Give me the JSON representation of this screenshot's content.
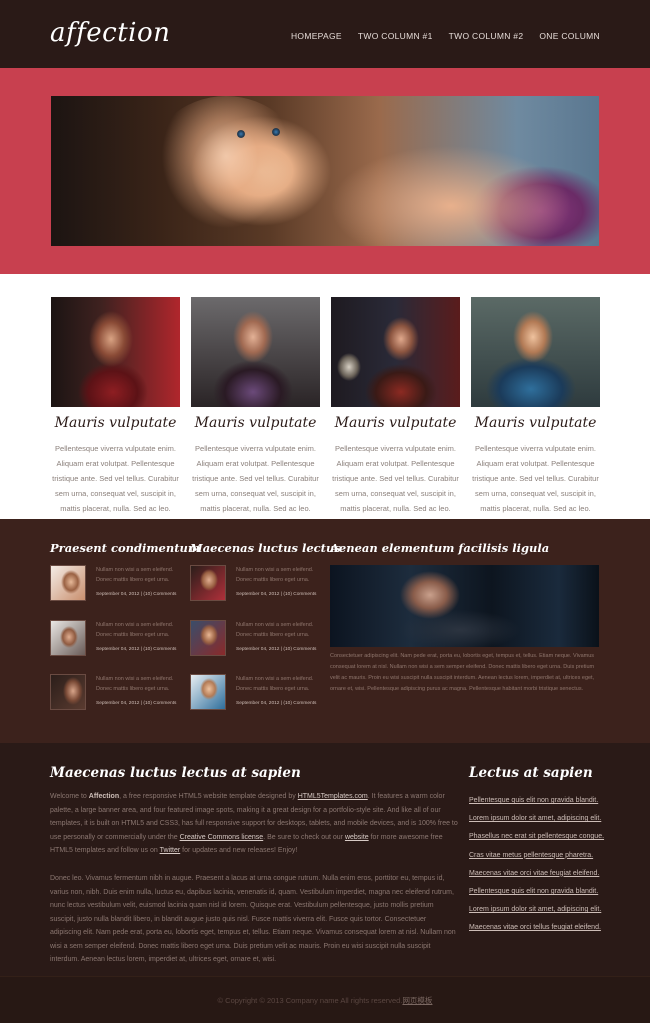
{
  "header": {
    "logo": "affection",
    "nav": [
      "HOMEPAGE",
      "TWO COLUMN #1",
      "TWO COLUMN #2",
      "ONE COLUMN"
    ]
  },
  "features": [
    {
      "title": "Mauris vulputate",
      "text": "Pellentesque viverra vulputate enim. Aliquam erat volutpat. Pellentesque tristique ante. Sed vel tellus. Curabitur sem urna, consequat vel, suscipit in, mattis placerat, nulla. Sed ac leo."
    },
    {
      "title": "Mauris vulputate",
      "text": "Pellentesque viverra vulputate enim. Aliquam erat volutpat. Pellentesque tristique ante. Sed vel tellus. Curabitur sem urna, consequat vel, suscipit in, mattis placerat, nulla. Sed ac leo."
    },
    {
      "title": "Mauris vulputate",
      "text": "Pellentesque viverra vulputate enim. Aliquam erat volutpat. Pellentesque tristique ante. Sed vel tellus. Curabitur sem urna, consequat vel, suscipit in, mattis placerat, nulla. Sed ac leo."
    },
    {
      "title": "Mauris vulputate",
      "text": "Pellentesque viverra vulputate enim. Aliquam erat volutpat. Pellentesque tristique ante. Sed vel tellus. Curabitur sem urna, consequat vel, suscipit in, mattis placerat, nulla. Sed ac leo."
    }
  ],
  "blog": {
    "col1_title": "Praesent condimentum",
    "col2_title": "Maecenas luctus lectus",
    "col3_title": "Aenean elementum facilisis ligula",
    "post_text": "Nullam non wisi a sem eleifend. Donec mattis libero eget urna.",
    "post_meta": "September 04, 2012 | (10) Comments",
    "feature_text": "Consectetuer adipiscing elit. Nam pede erat, porta eu, lobortis eget, tempus et, tellus. Etiam neque. Vivamus consequat lorem at nisl. Nullam non wisi a sem semper eleifend. Donec mattis libero eget urna. Duis pretium velit ac mauris. Proin eu wisi suscipit nulla suscipit interdum. Aenean lectus lorem, imperdiet at, ultrices eget, ornare et, wisi. Pellentesque adipiscing purus ac magna. Pellentesque habitant morbi tristique senectus."
  },
  "about": {
    "title": "Maecenas luctus lectus at sapien",
    "p1_a": "Welcome to ",
    "p1_b": "Affection",
    "p1_c": ", a free responsive HTML5 website template designed by ",
    "p1_link1": "HTML5Templates.com",
    "p1_d": ". It features a warm color palette, a large banner area, and four featured image spots, making it a great design for a portfolio-style site. And like all of our templates, it is built on HTML5 and CSS3, has full responsive support for desktops, tablets, and mobile devices, and is 100% free to use personally or commercially under the ",
    "p1_link2": "Creative Commons license",
    "p1_e": ". Be sure to check out our ",
    "p1_link3": "website",
    "p1_f": " for more awesome free HTML5 templates and follow us on ",
    "p1_link4": "Twitter",
    "p1_g": " for updates and new releases! Enjoy!",
    "p2": "Donec leo. Vivamus fermentum nibh in augue. Praesent a lacus at urna congue rutrum. Nulla enim eros, porttitor eu, tempus id, varius non, nibh. Duis enim nulla, luctus eu, dapibus lacinia, venenatis id, quam. Vestibulum imperdiet, magna nec eleifend rutrum, nunc lectus vestibulum velit, euismod lacinia quam nisl id lorem. Quisque erat. Vestibulum pellentesque, justo mollis pretium suscipit, justo nulla blandit libero, in blandit augue justo quis nisl. Fusce mattis viverra elit. Fusce quis tortor. Consectetuer adipiscing elit. Nam pede erat, porta eu, lobortis eget, tempus et, tellus. Etiam neque. Vivamus consequat lorem at nisl. Nullam non wisi a sem semper eleifend. Donec mattis libero eget urna. Duis pretium velit ac mauris. Proin eu wisi suscipit nulla suscipit interdum. Aenean lectus lorem, imperdiet at, ultrices eget, ornare et, wisi."
  },
  "sidebar": {
    "title": "Lectus at sapien",
    "links": [
      "Pellentesque quis elit non gravida blandit.",
      "Lorem ipsum dolor sit amet, adipiscing elit.",
      "Phasellus nec erat sit pellentesque congue.",
      "Cras vitae metus pellentesque pharetra.",
      "Maecenas vitae orci vitae feugiat eleifend.",
      "Pellentesque quis elit non gravida blandit.",
      "Lorem ipsum dolor sit amet, adipiscing elit.",
      "Maecenas vitae orci tellus feugiat eleifend."
    ]
  },
  "footer": {
    "copyright": "© Copyright © 2013 Company name All rights reserved.",
    "link": "网页模板"
  },
  "colors": {
    "banner": "#c8404f",
    "dark": "#2a1a17",
    "blog_bg": "#3c221c"
  }
}
